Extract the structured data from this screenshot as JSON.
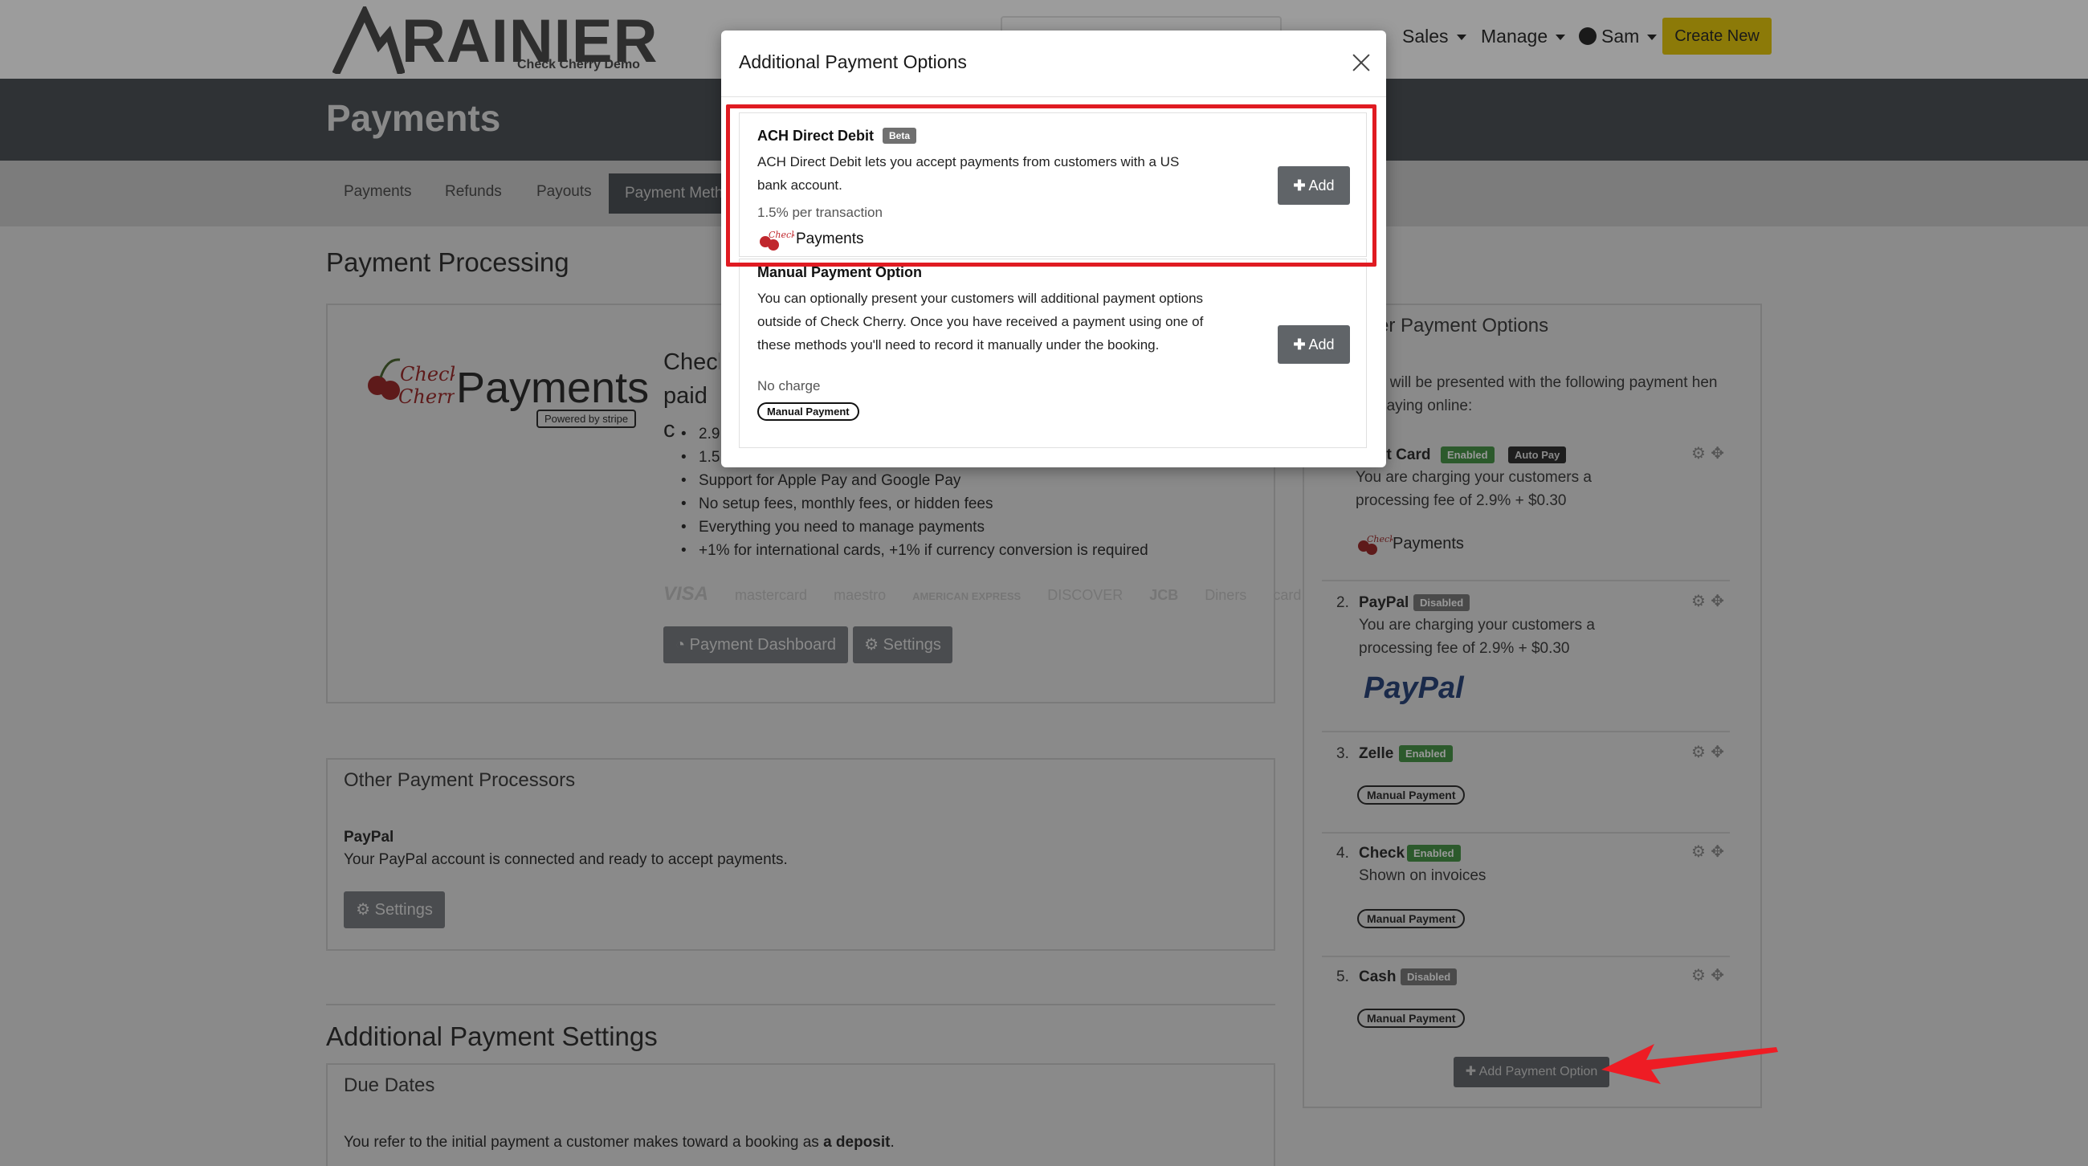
{
  "brand": {
    "name": "RAINIER",
    "subtitle": "Check Cherry Demo"
  },
  "nav": {
    "sales": "Sales",
    "manage": "Manage",
    "user": "Sam",
    "create_new": "Create New"
  },
  "page": {
    "title": "Payments"
  },
  "tabs": {
    "payments": "Payments",
    "refunds": "Refunds",
    "payouts": "Payouts",
    "payment_methods": "Payment Meth"
  },
  "payment_processing": {
    "heading": "Payment Processing",
    "logo_text": "Payments",
    "logo_script": "Check Cherry",
    "powered_by": "Powered by stripe",
    "head_lines": [
      "Check",
      "paid c"
    ],
    "features": [
      "2.9",
      "1.5",
      "Support for Apple Pay and Google Pay",
      "No setup fees, monthly fees, or hidden fees",
      "Everything you need to manage payments",
      "+1% for international cards, +1% if currency conversion is required"
    ],
    "card_brands": [
      "VISA",
      "mastercard",
      "maestro",
      "AMERICAN EXPRESS",
      "DISCOVER",
      "JCB",
      "Diners",
      "card"
    ],
    "dashboard_button": "Payment Dashboard",
    "settings_button": "Settings"
  },
  "other_processors": {
    "heading": "Other Payment Processors",
    "name": "PayPal",
    "text": "Your PayPal account is connected and ready to accept payments.",
    "settings_button": "Settings"
  },
  "additional_settings": {
    "heading": "Additional Payment Settings",
    "due_dates_title": "Due Dates",
    "due_dates_text_prefix": "You refer to the initial payment a customer makes toward a booking as ",
    "due_dates_text_bold": "a deposit",
    "due_dates_text_suffix": "."
  },
  "customer_options": {
    "heading": "er Payment Options",
    "intro": "s will be presented with the following payment hen paying online:",
    "items": [
      {
        "num": "",
        "name": "lit Card",
        "badge": "Enabled",
        "badge2": "Auto Pay",
        "desc": "You are charging your customers a processing fee of 2.9% + $0.30",
        "brand": "Payments"
      },
      {
        "num": "2.",
        "name": "PayPal",
        "badge": "Disabled",
        "desc": "You are charging your customers a processing fee of 2.9% + $0.30",
        "brand": "PayPal"
      },
      {
        "num": "3.",
        "name": "Zelle",
        "badge": "Enabled",
        "tag": "Manual Payment"
      },
      {
        "num": "4.",
        "name": "Check",
        "badge": "Enabled",
        "desc": "Shown on invoices",
        "tag": "Manual Payment"
      },
      {
        "num": "5.",
        "name": "Cash",
        "badge": "Disabled",
        "tag": "Manual Payment"
      }
    ],
    "add_button": "Add Payment Option"
  },
  "modal": {
    "title": "Additional Payment Options",
    "options": [
      {
        "name": "ACH Direct Debit",
        "badge": "Beta",
        "desc": "ACH Direct Debit lets you accept payments from customers with a US bank account.",
        "fee": "1.5% per transaction",
        "brand": "Payments",
        "add": "Add"
      },
      {
        "name": "Manual Payment Option",
        "desc": "You can optionally present your customers will additional payment options outside of Check Cherry. Once you have received a payment using one of these methods you'll need to record it manually under the booking.",
        "fee": "No charge",
        "tag": "Manual Payment",
        "add": "Add"
      }
    ]
  },
  "colors": {
    "highlight": "#e01b22",
    "arrow": "#ee1c24",
    "create_button": "#8c7a08",
    "enabled_badge": "#2c5a2c"
  }
}
